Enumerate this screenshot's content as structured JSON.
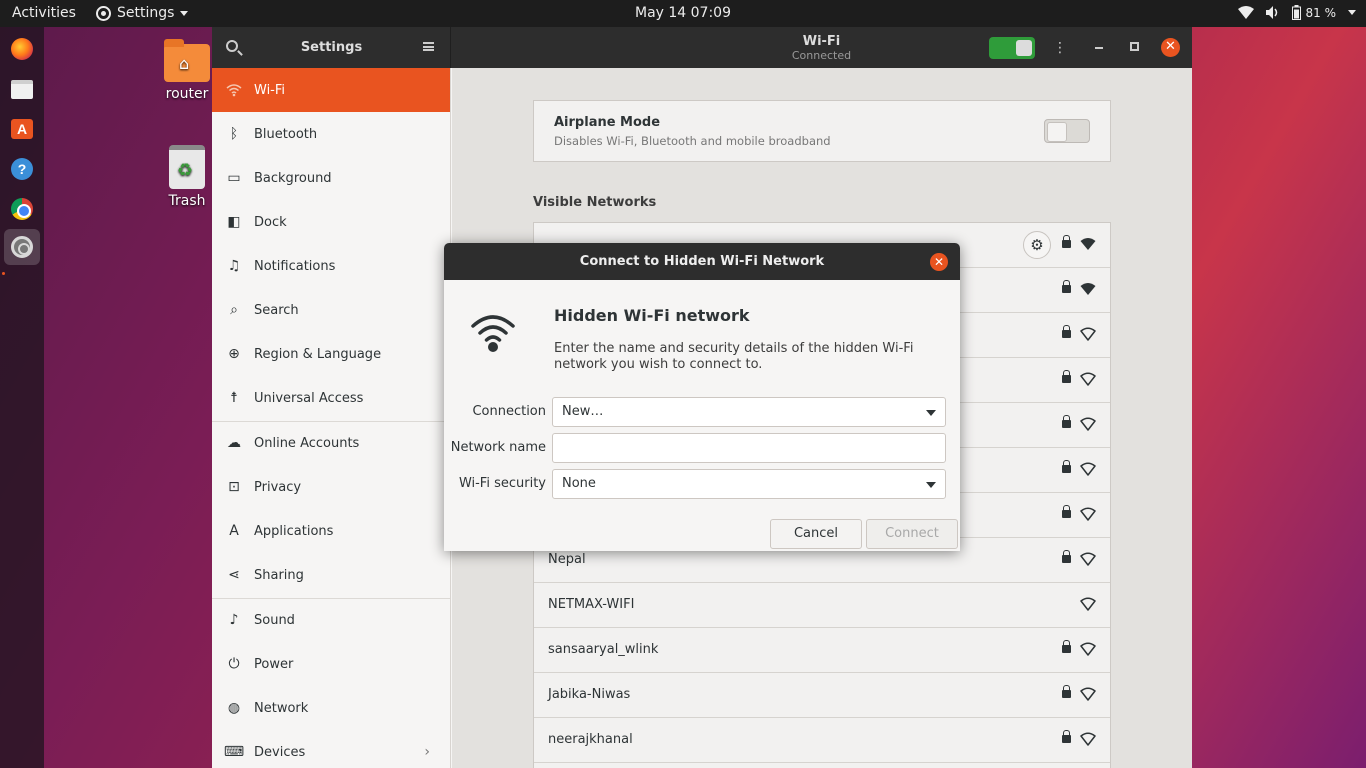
{
  "topbar": {
    "activities": "Activities",
    "app_name": "Settings",
    "clock": "May 14  07:09",
    "battery": "81 %"
  },
  "dock": {
    "items": [
      "firefox-icon",
      "files-icon",
      "software-icon",
      "help-icon",
      "chrome-icon",
      "settings-icon",
      "show-apps-icon"
    ]
  },
  "desktop": {
    "icons": [
      {
        "label": "router",
        "icon": "folder-icon"
      },
      {
        "label": "Trash",
        "icon": "trash-icon"
      }
    ]
  },
  "window": {
    "sidebar_title": "Settings",
    "header_title": "Wi-Fi",
    "header_subtitle": "Connected",
    "wifi_enabled": true
  },
  "sidebar": {
    "items": [
      {
        "label": "Wi-Fi",
        "icon": "wifi-icon",
        "active": true
      },
      {
        "label": "Bluetooth",
        "icon": "bluetooth-icon"
      },
      {
        "label": "Background",
        "icon": "background-icon"
      },
      {
        "label": "Dock",
        "icon": "dock-icon"
      },
      {
        "label": "Notifications",
        "icon": "bell-icon"
      },
      {
        "label": "Search",
        "icon": "search-icon"
      },
      {
        "label": "Region & Language",
        "icon": "globe-icon"
      },
      {
        "label": "Universal Access",
        "icon": "accessibility-icon"
      },
      {
        "label": "Online Accounts",
        "icon": "cloud-icon"
      },
      {
        "label": "Privacy",
        "icon": "lock-icon"
      },
      {
        "label": "Applications",
        "icon": "applications-icon"
      },
      {
        "label": "Sharing",
        "icon": "share-icon"
      },
      {
        "label": "Sound",
        "icon": "music-icon"
      },
      {
        "label": "Power",
        "icon": "power-icon"
      },
      {
        "label": "Network",
        "icon": "network-icon"
      },
      {
        "label": "Devices",
        "icon": "devices-icon"
      }
    ]
  },
  "main": {
    "airplane_title": "Airplane Mode",
    "airplane_desc": "Disables Wi-Fi, Bluetooth and mobile broadband",
    "airplane_enabled": false,
    "visible_networks_title": "Visible Networks",
    "networks": [
      {
        "name": "",
        "locked": true,
        "connected": true
      },
      {
        "name": "",
        "locked": true
      },
      {
        "name": "",
        "locked": true
      },
      {
        "name": "",
        "locked": true
      },
      {
        "name": "",
        "locked": true
      },
      {
        "name": "",
        "locked": true
      },
      {
        "name": "",
        "locked": true
      },
      {
        "name": "Nepal",
        "locked": true
      },
      {
        "name": "NETMAX-WIFI",
        "locked": false
      },
      {
        "name": "sansaaryal_wlink",
        "locked": true
      },
      {
        "name": "Jabika-Niwas",
        "locked": true
      },
      {
        "name": "neerajkhanal",
        "locked": true
      }
    ]
  },
  "dialog": {
    "title": "Connect to Hidden Wi-Fi Network",
    "heading": "Hidden Wi-Fi network",
    "description": "Enter the name and security details of the hidden Wi-Fi network you wish to connect to.",
    "connection_label": "Connection",
    "connection_value": "New…",
    "network_name_label": "Network name",
    "network_name_value": "",
    "security_label": "Wi-Fi security",
    "security_value": "None",
    "cancel": "Cancel",
    "connect": "Connect"
  },
  "colors": {
    "accent": "#e95420",
    "switch_on": "#2f9c3a",
    "headerbar": "#2d2d2d"
  }
}
